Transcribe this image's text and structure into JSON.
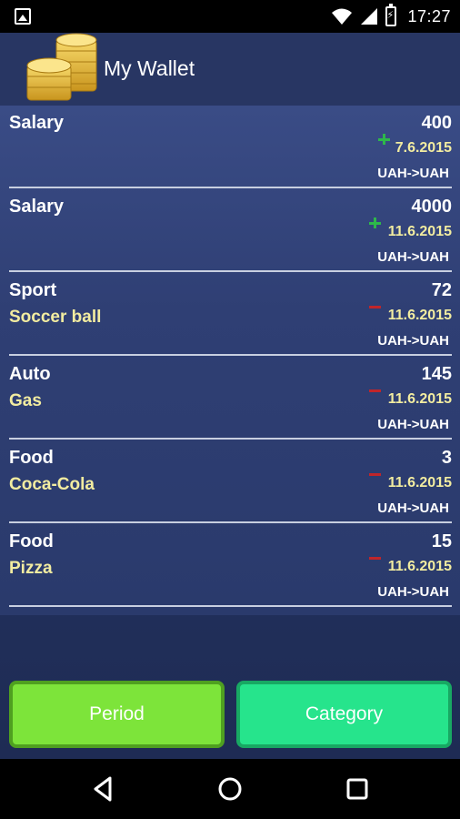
{
  "status_bar": {
    "time": "17:27",
    "icons": [
      "gallery-icon",
      "wifi-icon",
      "signal-icon",
      "battery-charging-icon"
    ]
  },
  "app": {
    "title": "My Wallet",
    "logo_icon": "coins-icon"
  },
  "transactions": [
    {
      "category": "Salary",
      "description": "",
      "amount": "400",
      "date": "7.6.2015",
      "currency": "UAH->UAH",
      "type": "income"
    },
    {
      "category": "Salary",
      "description": "",
      "amount": "4000",
      "date": "11.6.2015",
      "currency": "UAH->UAH",
      "type": "income"
    },
    {
      "category": "Sport",
      "description": "Soccer ball",
      "amount": "72",
      "date": "11.6.2015",
      "currency": "UAH->UAH",
      "type": "expense"
    },
    {
      "category": "Auto",
      "description": "Gas",
      "amount": "145",
      "date": "11.6.2015",
      "currency": "UAH->UAH",
      "type": "expense"
    },
    {
      "category": "Food",
      "description": "Coca-Cola",
      "amount": "3",
      "date": "11.6.2015",
      "currency": "UAH->UAH",
      "type": "expense"
    },
    {
      "category": "Food",
      "description": "Pizza",
      "amount": "15",
      "date": "11.6.2015",
      "currency": "UAH->UAH",
      "type": "expense"
    }
  ],
  "buttons": {
    "period": "Period",
    "category": "Category"
  },
  "nav": {
    "icons": [
      "back-icon",
      "home-icon",
      "recents-icon"
    ]
  },
  "colors": {
    "income": "#2db84a",
    "expense": "#c0252a",
    "period_button": "#7de43a",
    "category_button": "#26e48c",
    "description_text": "#f2eca0"
  }
}
